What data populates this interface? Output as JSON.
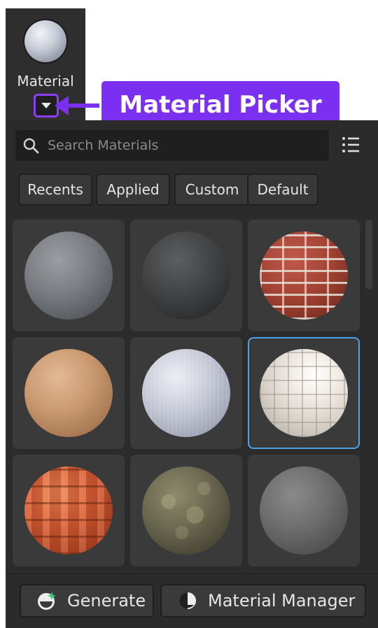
{
  "toolbar": {
    "label": "Material",
    "icon": "material-sphere-icon",
    "dropdown_icon": "caret-down-icon"
  },
  "callout": {
    "text": "Material Picker",
    "color": "#7b2ff0"
  },
  "search": {
    "placeholder": "Search Materials",
    "icon": "search-icon"
  },
  "view_toggle_icon": "list-view-icon",
  "tabs": [
    {
      "label": "Recents"
    },
    {
      "label": "Applied"
    },
    {
      "label": "Custom"
    },
    {
      "label": "Default"
    }
  ],
  "materials": [
    {
      "name": "concrete",
      "icon": "concrete-sphere"
    },
    {
      "name": "slate",
      "icon": "slate-sphere"
    },
    {
      "name": "brick",
      "icon": "brick-sphere"
    },
    {
      "name": "sandstone",
      "icon": "sandstone-sphere"
    },
    {
      "name": "fabric",
      "icon": "fabric-sphere"
    },
    {
      "name": "ceramic-tiles",
      "icon": "ceramic-tiles-sphere",
      "selected": true
    },
    {
      "name": "clay-roof-tiles",
      "icon": "roof-tiles-sphere"
    },
    {
      "name": "cobblestone",
      "icon": "cobblestone-sphere"
    },
    {
      "name": "smooth-plastic",
      "icon": "smooth-sphere"
    }
  ],
  "footer": {
    "generate_label": "Generate",
    "generate_icon": "sparkle-sphere-icon",
    "manager_label": "Material Manager",
    "manager_icon": "half-sphere-icon"
  },
  "colors": {
    "accent": "#7b2ff0",
    "selection": "#4aa3e8",
    "panel": "#2b2b2b"
  }
}
